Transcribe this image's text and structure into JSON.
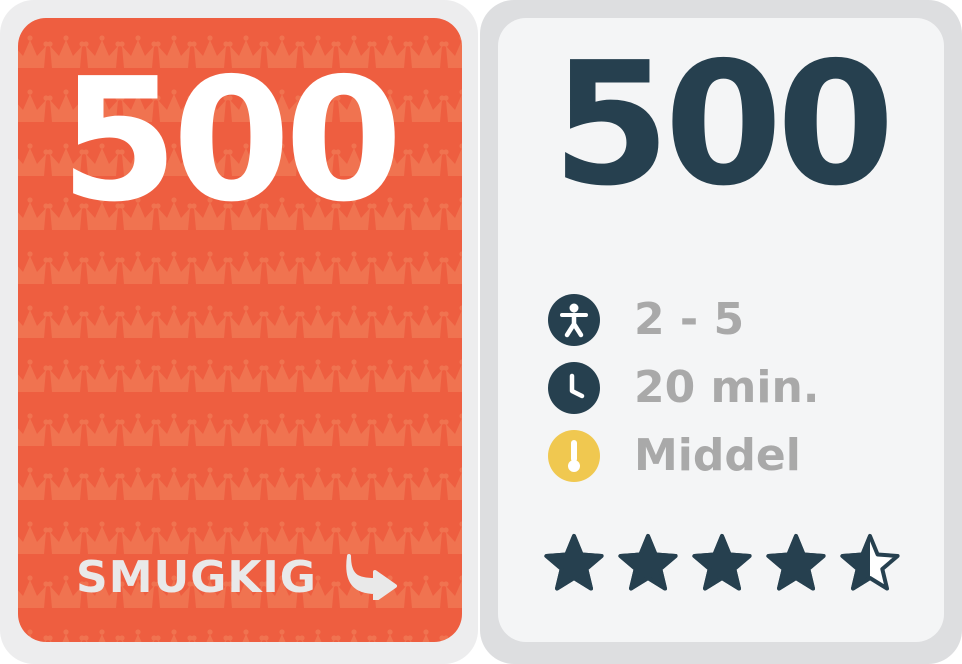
{
  "front": {
    "number": "500",
    "peek_label": "SMUGKIG",
    "peek_icon": "curved-arrow-right-icon",
    "background_color": "#ee5e40",
    "pattern_icon": "crown-icon"
  },
  "back": {
    "number": "500",
    "info": [
      {
        "icon": "person-icon",
        "text": "2 - 5",
        "icon_color": "#26404f"
      },
      {
        "icon": "clock-icon",
        "text": "20 min.",
        "icon_color": "#26404f"
      },
      {
        "icon": "thermometer-icon",
        "text": "Middel",
        "icon_color": "#f0c850"
      }
    ],
    "rating": 4.5,
    "rating_max": 5,
    "star_color": "#26404f"
  }
}
